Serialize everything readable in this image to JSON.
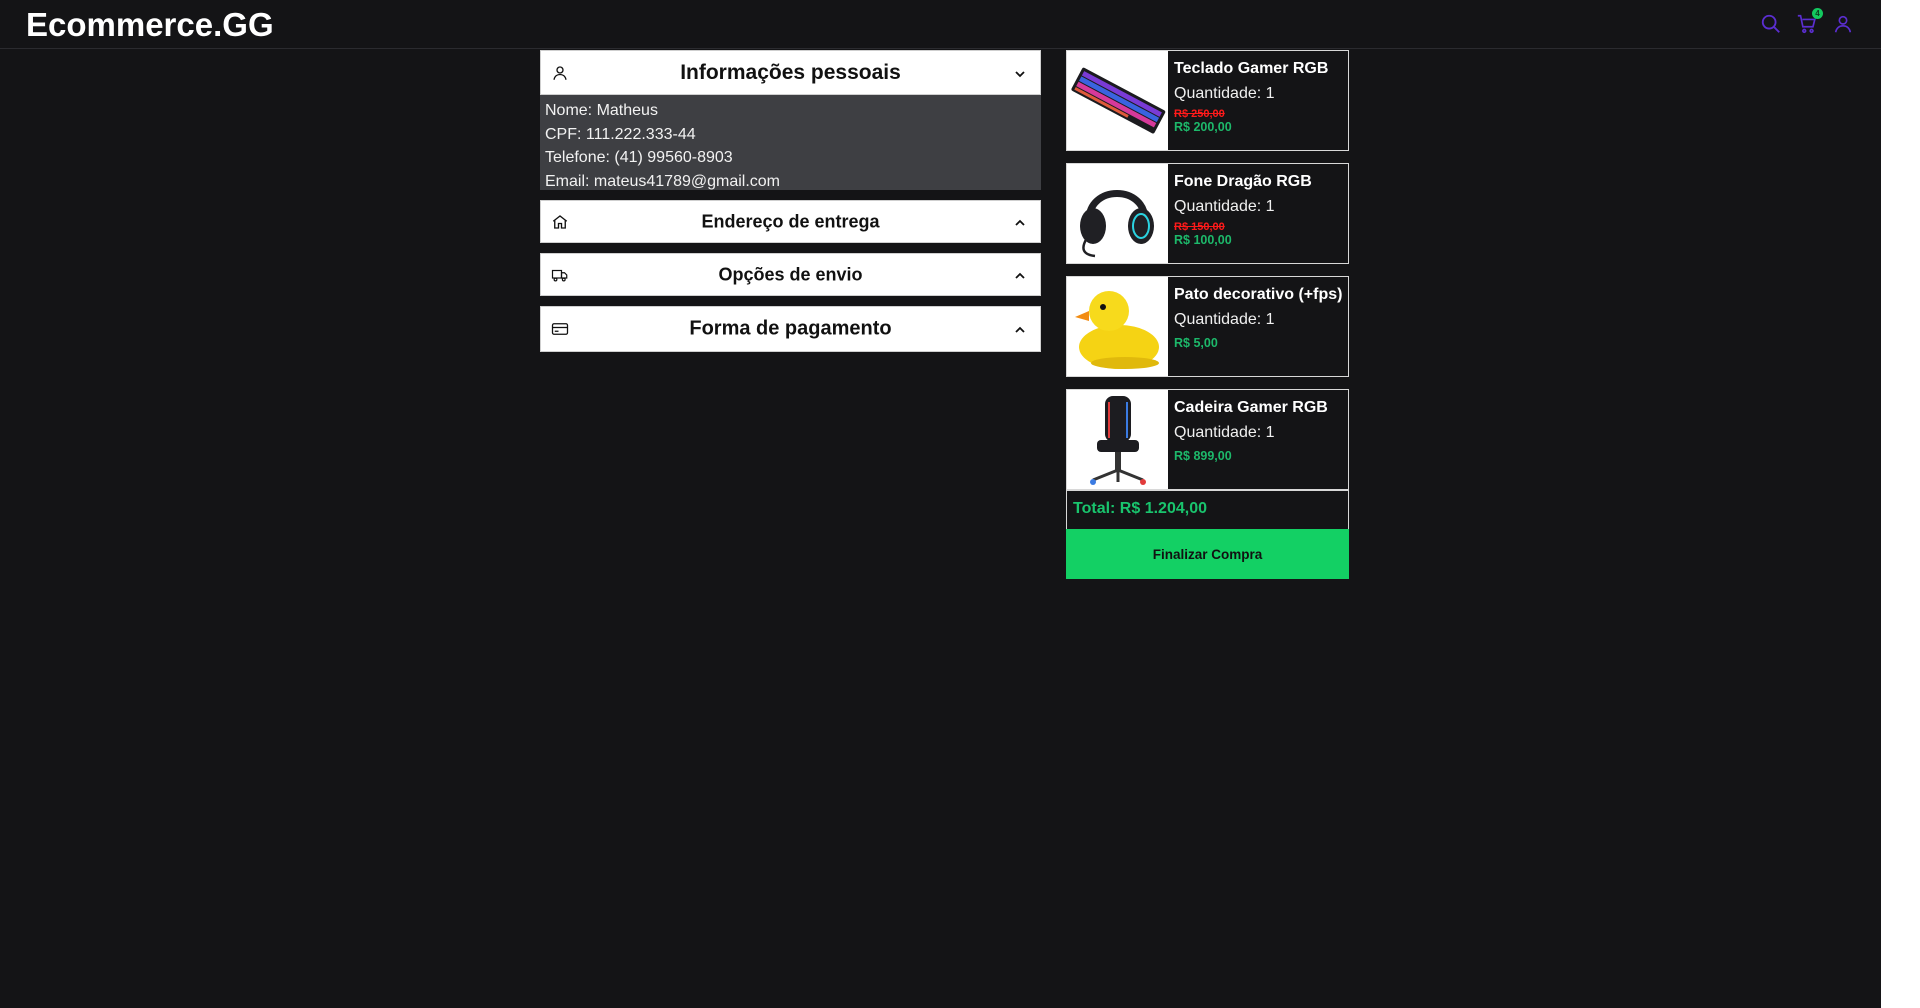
{
  "header": {
    "logo": "Ecommerce.GG",
    "cart_count": "4",
    "icon_color": "#5b2ed1"
  },
  "personal": {
    "title": "Informações pessoais",
    "name_line": "Nome: Matheus",
    "cpf_line": "CPF: 111.222.333-44",
    "phone_line": "Telefone: (41) 99560-8903",
    "email_line": "Email: mateus41789@gmail.com"
  },
  "address": {
    "title": "Endereço de entrega"
  },
  "shipping": {
    "title": "Opções de envio"
  },
  "payment": {
    "title": "Forma de pagamento"
  },
  "cart": {
    "items": [
      {
        "name": "Teclado Gamer RGB",
        "qty": "Quantidade: 1",
        "old_price": "R$ 250,00",
        "price": "R$ 200,00",
        "image": "keyboard-image"
      },
      {
        "name": "Fone Dragão RGB",
        "qty": "Quantidade: 1",
        "old_price": "R$ 150,00",
        "price": "R$ 100,00",
        "image": "headset-image"
      },
      {
        "name": "Pato decorativo (+fps)",
        "qty": "Quantidade: 1",
        "price": "R$ 5,00",
        "image": "rubber-duck-image"
      },
      {
        "name": "Cadeira Gamer RGB",
        "qty": "Quantidade: 1",
        "price": "R$ 899,00",
        "image": "gamer-chair-image"
      }
    ],
    "total": "Total: R$ 1.204,00",
    "checkout_label": "Finalizar Compra"
  },
  "colors": {
    "background": "#141416",
    "accent_green": "#13d064",
    "price_green": "#1db86a",
    "old_price_red": "#ff1a1a",
    "panel_gray": "#3e3f43"
  }
}
